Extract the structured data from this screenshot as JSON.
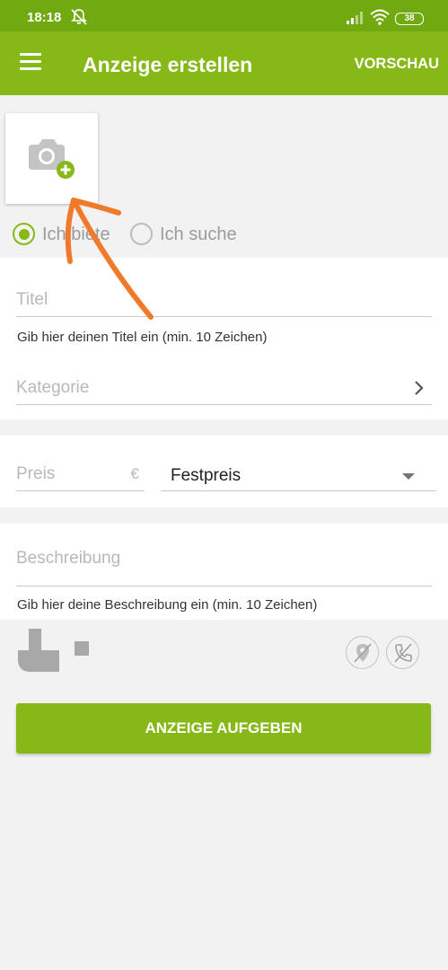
{
  "status_bar": {
    "time": "18:18",
    "battery": "38"
  },
  "app_bar": {
    "title": "Anzeige erstellen",
    "preview_label": "VORSCHAU"
  },
  "offer_type": {
    "offer_label": "Ich biete",
    "search_label": "Ich suche",
    "selected": "Ich biete"
  },
  "form": {
    "title_placeholder": "Titel",
    "title_helper": "Gib hier deinen Titel ein (min. 10 Zeichen)",
    "category_placeholder": "Kategorie",
    "price_placeholder": "Preis",
    "currency": "€",
    "price_type": "Festpreis",
    "description_placeholder": "Beschreibung",
    "description_helper": "Gib hier deine Beschreibung ein (min. 10 Zeichen)"
  },
  "submit_label": "ANZEIGE AUFGEBEN",
  "colors": {
    "status_bar": "#71a910",
    "app_bar": "#86b817",
    "accent": "#86b817",
    "annotation_arrow": "#f07a2a"
  }
}
